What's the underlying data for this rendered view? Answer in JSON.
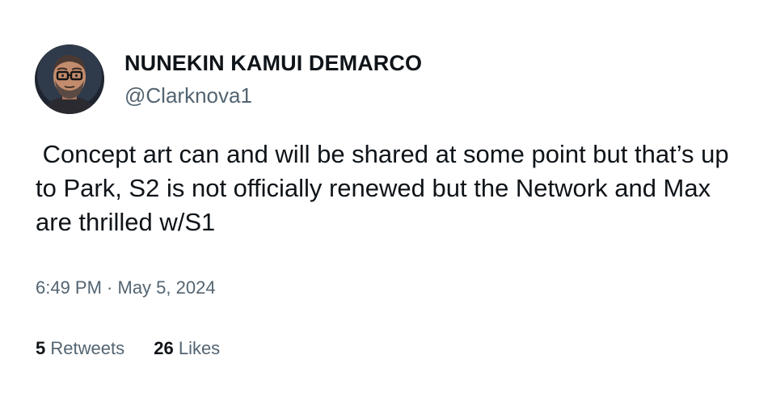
{
  "author": {
    "display_name": "NUNEKIN KAMUI DEMARCO",
    "handle": "@Clarknova1",
    "avatar_icon": "user-avatar-icon"
  },
  "tweet": {
    "text": " Concept art can and will be shared at some point but that’s up to Park, S2 is not officially renewed but the Network and Max are thrilled w/S1",
    "time": "6:49 PM",
    "separator": " · ",
    "date": "May 5, 2024"
  },
  "stats": {
    "retweets_count": "5",
    "retweets_label": "Retweets",
    "likes_count": "26",
    "likes_label": "Likes"
  },
  "colors": {
    "primary_text": "#0f1419",
    "secondary_text": "#536471",
    "background": "#ffffff"
  }
}
